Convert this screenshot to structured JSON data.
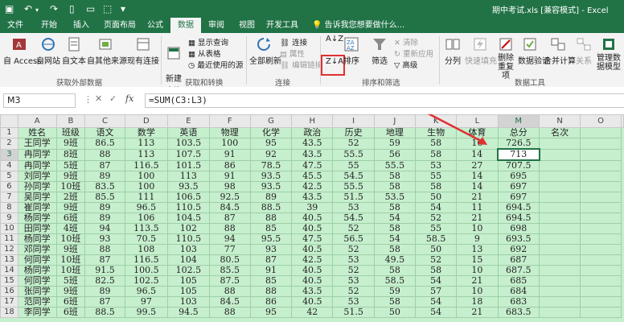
{
  "title_bar": {
    "filename": "期中考试.xls",
    "mode": "[兼容模式]",
    "app": "Excel"
  },
  "tabs": [
    "文件",
    "开始",
    "插入",
    "页面布局",
    "公式",
    "数据",
    "审阅",
    "视图",
    "开发工具"
  ],
  "active_tab": "数据",
  "tell_me": "告诉我您想要做什么...",
  "ribbon": {
    "groups": {
      "external": "获取外部数据",
      "transform": "获取和转换",
      "connections": "连接",
      "sort_filter": "排序和筛选",
      "data_tools": "数据工具"
    },
    "external_buttons": [
      "自 Access",
      "自网站",
      "自文本",
      "自其他来源",
      "现有连接"
    ],
    "transform": {
      "new_query": "新建\n查询",
      "show_queries": "显示查询",
      "from_table": "从表格",
      "recent_sources": "最近使用的源"
    },
    "connections": {
      "refresh_all": "全部刷新",
      "connections": "连接",
      "properties": "属性",
      "edit_links": "编辑链接"
    },
    "sort_filter": {
      "sort": "排序",
      "filter": "筛选",
      "clear": "清除",
      "reapply": "重新应用",
      "advanced": "高级"
    },
    "data_tools": {
      "text_to_columns": "分列",
      "flash_fill": "快速填充",
      "remove_duplicates": "删除重复项",
      "data_validation": "数据验证",
      "consolidate": "合并计算",
      "relationships": "关系",
      "manage_model": "管理数据模型"
    }
  },
  "formula_bar": {
    "name_box": "M3",
    "fx": "fx",
    "formula": "=SUM(C3:L3)"
  },
  "columns": [
    "A",
    "B",
    "C",
    "D",
    "E",
    "F",
    "G",
    "H",
    "I",
    "J",
    "K",
    "L",
    "M",
    "N",
    "O"
  ],
  "rows": [
    [
      "1",
      "姓名",
      "班级",
      "语文",
      "数学",
      "英语",
      "物理",
      "化学",
      "政治",
      "历史",
      "地理",
      "生物",
      "体育",
      "总分",
      "名次",
      ""
    ],
    [
      "2",
      "王同学",
      "9班",
      "86.5",
      "113",
      "103.5",
      "100",
      "95",
      "43.5",
      "52",
      "59",
      "58",
      "16",
      "726.5",
      "",
      ""
    ],
    [
      "3",
      "冉同学",
      "8班",
      "88",
      "113",
      "107.5",
      "91",
      "92",
      "43.5",
      "55.5",
      "56",
      "58",
      "14",
      "713",
      "",
      ""
    ],
    [
      "4",
      "冉同学",
      "5班",
      "87",
      "116.5",
      "101.5",
      "86",
      "78.5",
      "47.5",
      "55",
      "55.5",
      "53",
      "27",
      "707.5",
      "",
      ""
    ],
    [
      "5",
      "刘同学",
      "9班",
      "89",
      "100",
      "113",
      "91",
      "93.5",
      "45.5",
      "54.5",
      "58",
      "55",
      "14",
      "695",
      "",
      ""
    ],
    [
      "6",
      "孙同学",
      "10班",
      "83.5",
      "100",
      "93.5",
      "98",
      "93.5",
      "42.5",
      "55.5",
      "58",
      "58",
      "14",
      "697",
      "",
      ""
    ],
    [
      "7",
      "吴同学",
      "2班",
      "85.5",
      "111",
      "106.5",
      "92.5",
      "89",
      "43.5",
      "51.5",
      "53.5",
      "50",
      "21",
      "697",
      "",
      ""
    ],
    [
      "8",
      "崔同学",
      "9班",
      "89",
      "96.5",
      "110.5",
      "84.5",
      "88.5",
      "39",
      "53",
      "58",
      "54",
      "11",
      "694.5",
      "",
      ""
    ],
    [
      "9",
      "杨同学",
      "6班",
      "89",
      "106",
      "104.5",
      "87",
      "88",
      "40.5",
      "54.5",
      "54",
      "52",
      "21",
      "694.5",
      "",
      ""
    ],
    [
      "10",
      "田同学",
      "4班",
      "94",
      "113.5",
      "102",
      "88",
      "85",
      "40.5",
      "52",
      "58",
      "55",
      "10",
      "698",
      "",
      ""
    ],
    [
      "11",
      "杨同学",
      "10班",
      "93",
      "70.5",
      "110.5",
      "94",
      "95.5",
      "47.5",
      "56.5",
      "54",
      "58.5",
      "9",
      "693.5",
      "",
      ""
    ],
    [
      "12",
      "邓同学",
      "9班",
      "88",
      "108",
      "103",
      "77",
      "93",
      "40.5",
      "52",
      "58",
      "50",
      "13",
      "692",
      "",
      ""
    ],
    [
      "13",
      "何同学",
      "10班",
      "87",
      "116.5",
      "104",
      "80.5",
      "87",
      "42.5",
      "53",
      "49.5",
      "52",
      "15",
      "687",
      "",
      ""
    ],
    [
      "14",
      "杨同学",
      "10班",
      "91.5",
      "100.5",
      "102.5",
      "85.5",
      "91",
      "40.5",
      "52",
      "58",
      "58",
      "10",
      "687.5",
      "",
      ""
    ],
    [
      "15",
      "何同学",
      "5班",
      "82.5",
      "102.5",
      "105",
      "87.5",
      "85",
      "40.5",
      "53",
      "58.5",
      "54",
      "21",
      "685",
      "",
      ""
    ],
    [
      "16",
      "张同学",
      "9班",
      "89",
      "96.5",
      "105",
      "88",
      "88",
      "43.5",
      "52",
      "59",
      "57",
      "10",
      "684",
      "",
      ""
    ],
    [
      "17",
      "范同学",
      "6班",
      "87",
      "97",
      "103",
      "84.5",
      "86",
      "40.5",
      "53",
      "58",
      "54",
      "18",
      "683",
      "",
      ""
    ],
    [
      "18",
      "李同学",
      "6班",
      "88.5",
      "99.5",
      "94.5",
      "88",
      "95",
      "42",
      "51.5",
      "50",
      "54",
      "21",
      "683.5",
      "",
      ""
    ]
  ]
}
